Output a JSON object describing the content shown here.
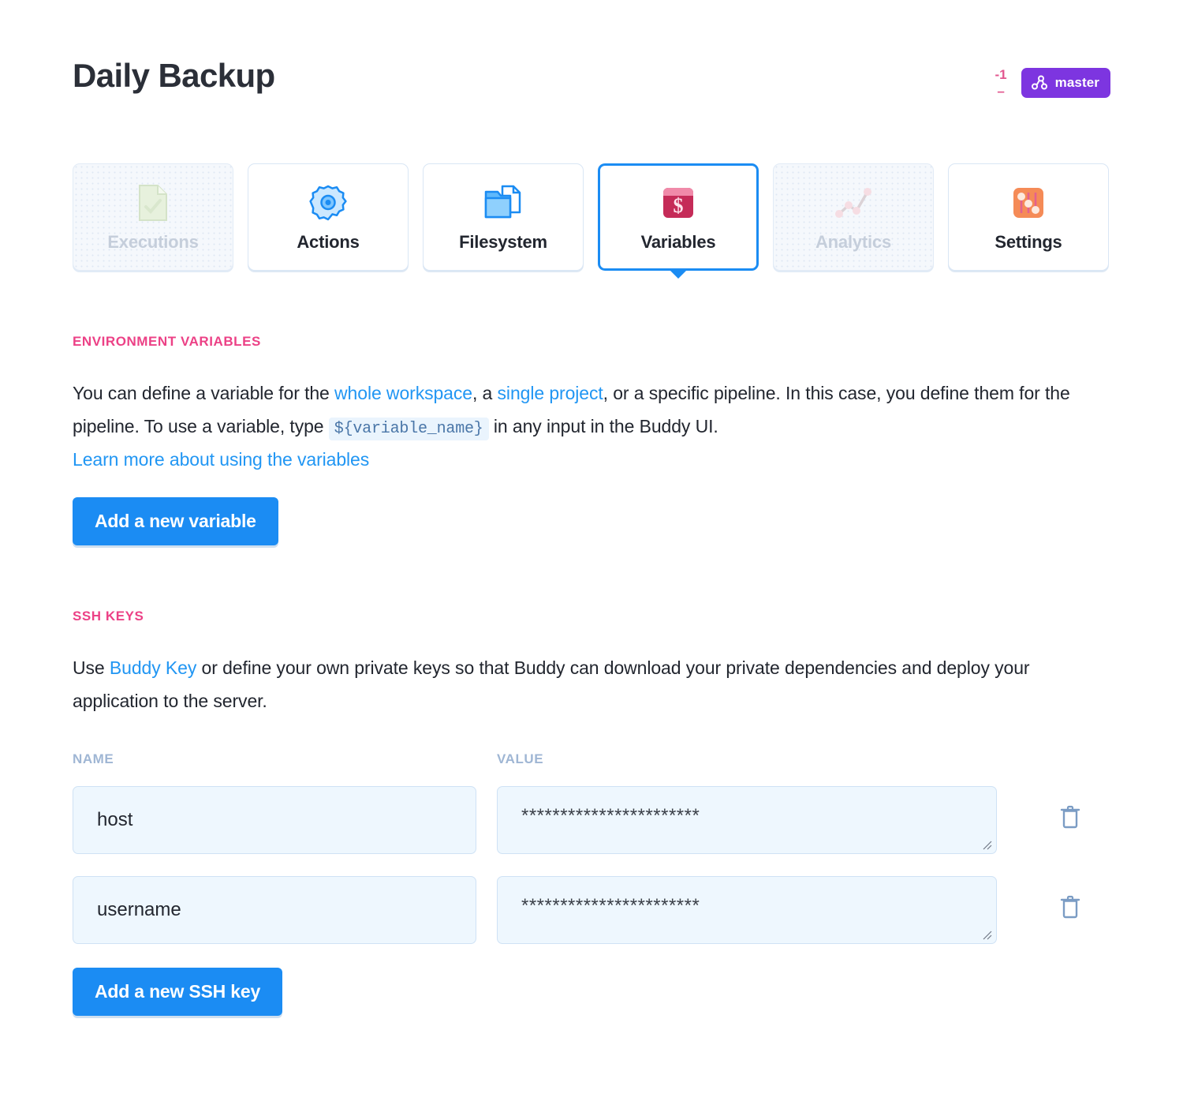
{
  "header": {
    "title": "Daily Backup",
    "commits_behind": "-1",
    "commits_ahead": "–",
    "branch": "master",
    "branch_icon": "git-branch-icon"
  },
  "tabs": [
    {
      "label": "Executions",
      "icon": "document-check-icon",
      "state": "disabled"
    },
    {
      "label": "Actions",
      "icon": "gear-icon",
      "state": "enabled"
    },
    {
      "label": "Filesystem",
      "icon": "folder-file-icon",
      "state": "enabled"
    },
    {
      "label": "Variables",
      "icon": "dollar-card-icon",
      "state": "active"
    },
    {
      "label": "Analytics",
      "icon": "line-chart-icon",
      "state": "disabled"
    },
    {
      "label": "Settings",
      "icon": "sliders-icon",
      "state": "enabled"
    }
  ],
  "environment_variables": {
    "section_title": "ENVIRONMENT VARIABLES",
    "text_part_1": "You can define a variable for the ",
    "link_workspace": "whole workspace",
    "text_part_2": ", a ",
    "link_project": "single project",
    "text_part_3": ", or a specific pipeline. In this case, you define them for the pipeline. To use a variable, type ",
    "code_snippet": "${variable_name}",
    "text_part_4": " in any input in the Buddy UI.",
    "learn_more_link": "Learn more about using the variables",
    "add_button": "Add a new variable"
  },
  "ssh_keys": {
    "section_title": "SSH KEYS",
    "text_part_1": "Use ",
    "link_buddy_key": "Buddy Key",
    "text_part_2": " or define your own private keys so that Buddy can download your private dependencies and deploy your application to the server.",
    "columns": {
      "name": "NAME",
      "value": "VALUE"
    },
    "rows": [
      {
        "name": "host",
        "value": "***********************",
        "delete_icon": "trash-icon"
      },
      {
        "name": "username",
        "value": "***********************",
        "delete_icon": "trash-icon"
      }
    ],
    "add_button": "Add a new SSH key"
  },
  "colors": {
    "accent_blue": "#1b8cf3",
    "section_pink": "#ec4186",
    "branch_purple": "#7d35e0",
    "link_blue": "#2196f3",
    "input_bg": "#eef7fe",
    "col_head": "#9fb6d4"
  }
}
